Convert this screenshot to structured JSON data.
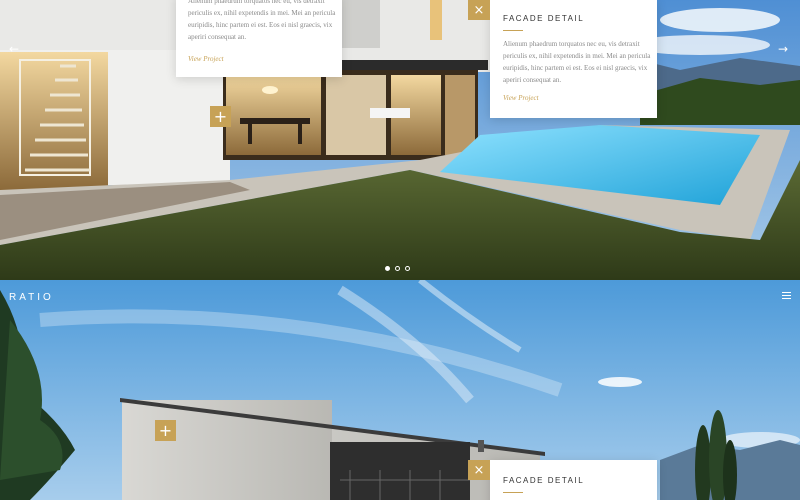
{
  "brand": {
    "logo": "RATIO"
  },
  "top_slide": {
    "left_card_text": "Alienum phaedrum torquatos nec eu, vis detraxit periculis ex, nihil expetendis in mei. Mei an pericula euripidis, hinc partem ei est. Eos ei nisl graecis, vix aperiri consequat an.",
    "left_card_link": "View Project",
    "right_card_title": "FACADE DETAIL",
    "right_card_text": "Alienum phaedrum torquatos nec eu, vis detraxit periculis ex, nihil expetendis in mei. Mei an pericula euripidis, hinc partem ei est. Eos ei nisl graecis, vix aperiri consequat an.",
    "right_card_link": "View Project",
    "prev_arrow": "←",
    "next_arrow": "→",
    "plus_icon": "+",
    "close_icon": "×",
    "dots": [
      "active",
      "",
      ""
    ]
  },
  "bottom_slide": {
    "card_title": "FACADE DETAIL",
    "plus_icon": "+",
    "close_icon": "×"
  },
  "icons": [
    "arrow-left-icon",
    "arrow-right-icon",
    "plus-icon",
    "close-icon",
    "hamburger-menu-icon"
  ],
  "colors": {
    "accent": "#c7a256",
    "sky": "#6aaee0",
    "pool": "#3fc2f0",
    "grass": "#4a5a2a"
  }
}
